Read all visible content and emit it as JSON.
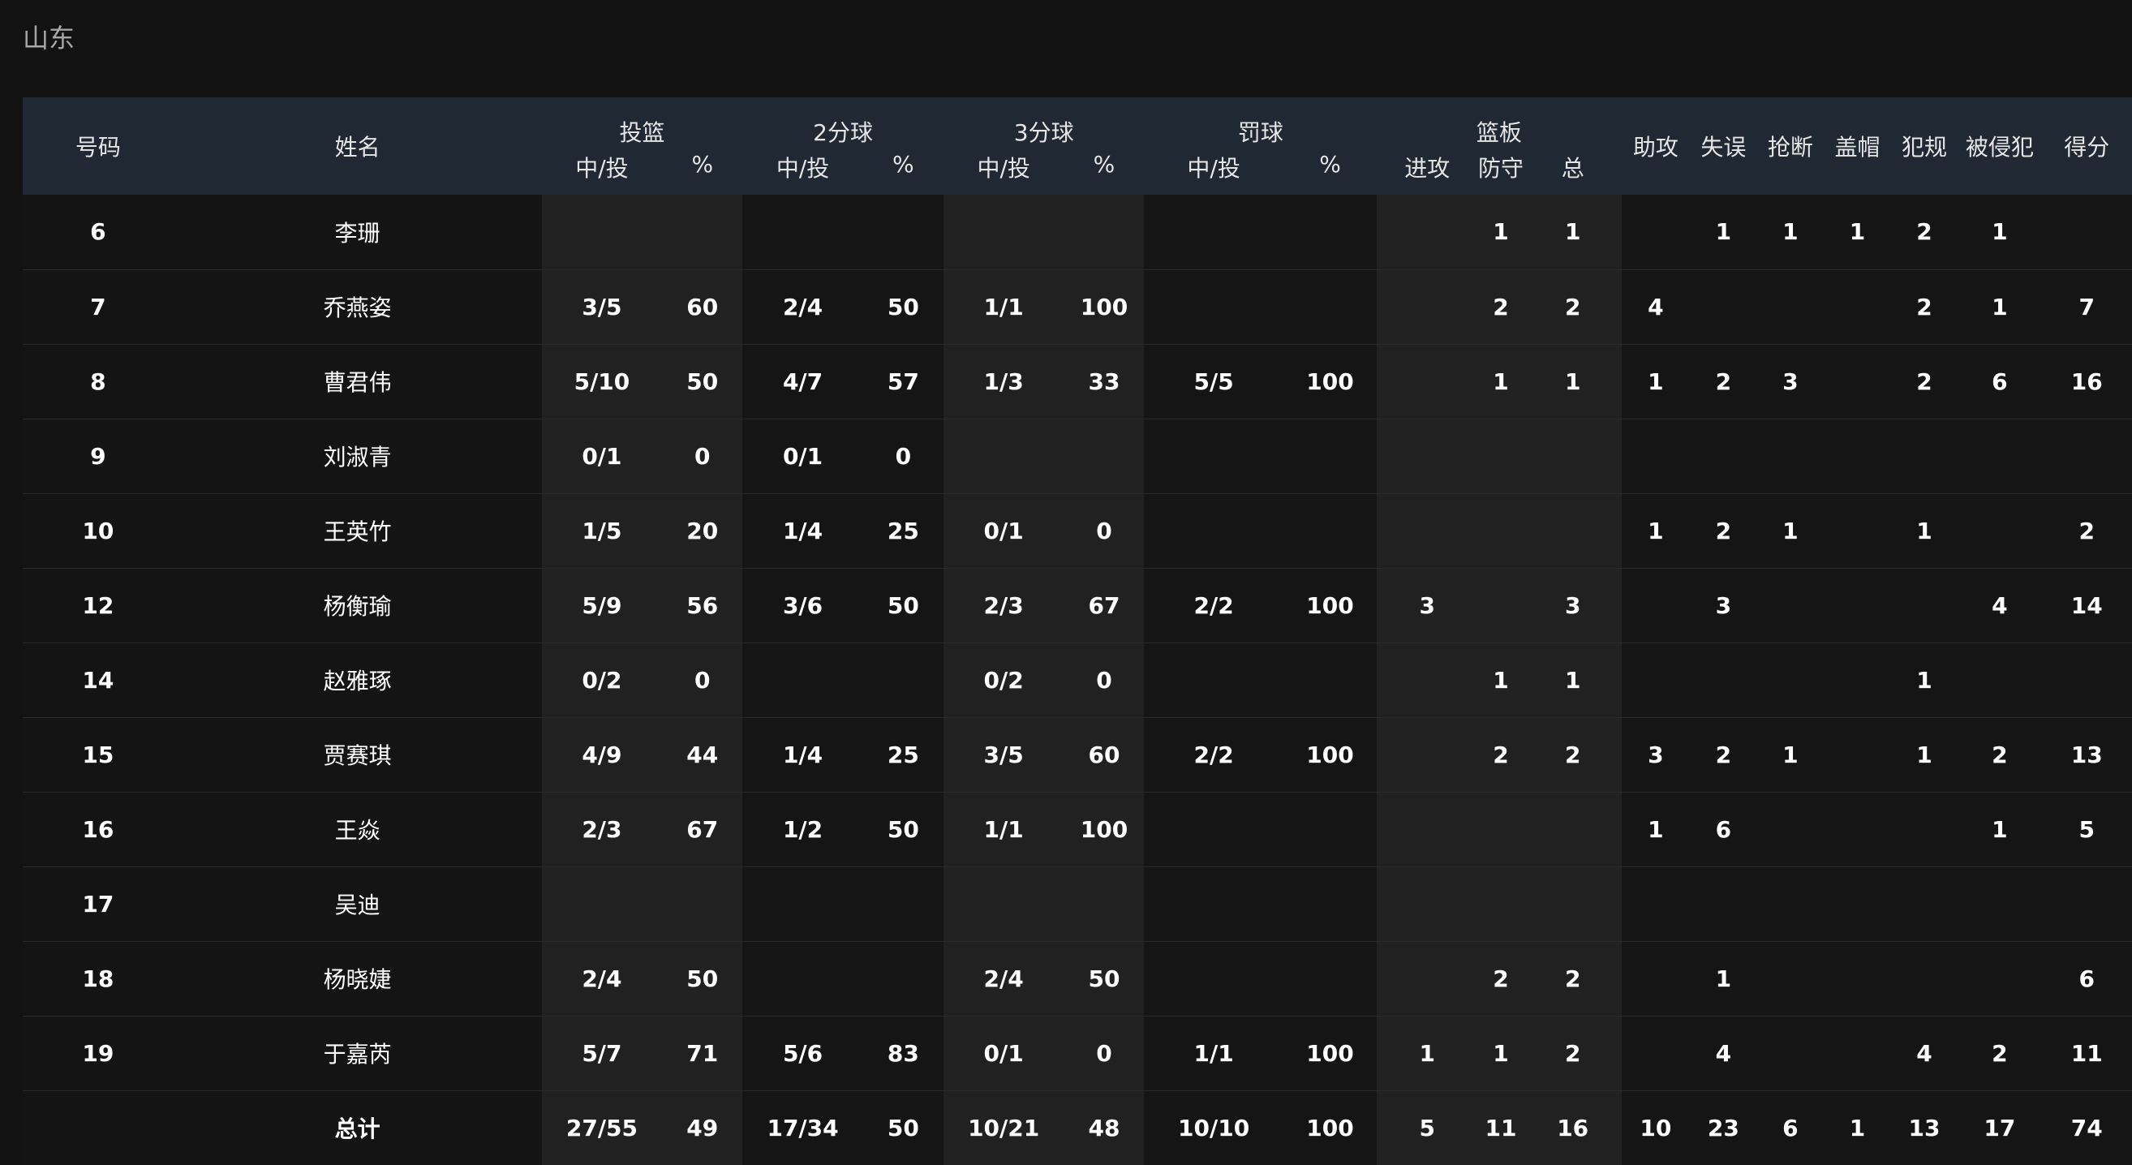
{
  "team": "山东",
  "headers": {
    "number": "号码",
    "name": "姓名",
    "groups": {
      "fg": "投篮",
      "two": "2分球",
      "three": "3分球",
      "ft": "罚球",
      "reb": "篮板"
    },
    "sub": {
      "made_att": "中/投",
      "pct": "%",
      "off": "进攻",
      "def": "防守",
      "tot": "总"
    },
    "ast": "助攻",
    "tov": "失误",
    "stl": "抢断",
    "blk": "盖帽",
    "pf": "犯规",
    "fd": "被侵犯",
    "pts": "得分"
  },
  "rows": [
    {
      "no": "6",
      "name": "李珊",
      "fg": "",
      "fg_pct": "",
      "two": "",
      "two_pct": "",
      "three": "",
      "three_pct": "",
      "ft": "",
      "ft_pct": "",
      "off": "",
      "def": "1",
      "tot": "1",
      "ast": "",
      "tov": "1",
      "stl": "1",
      "blk": "1",
      "pf": "2",
      "fd": "1",
      "pts": ""
    },
    {
      "no": "7",
      "name": "乔燕姿",
      "fg": "3/5",
      "fg_pct": "60",
      "two": "2/4",
      "two_pct": "50",
      "three": "1/1",
      "three_pct": "100",
      "ft": "",
      "ft_pct": "",
      "off": "",
      "def": "2",
      "tot": "2",
      "ast": "4",
      "tov": "",
      "stl": "",
      "blk": "",
      "pf": "2",
      "fd": "1",
      "pts": "7"
    },
    {
      "no": "8",
      "name": "曹君伟",
      "fg": "5/10",
      "fg_pct": "50",
      "two": "4/7",
      "two_pct": "57",
      "three": "1/3",
      "three_pct": "33",
      "ft": "5/5",
      "ft_pct": "100",
      "off": "",
      "def": "1",
      "tot": "1",
      "ast": "1",
      "tov": "2",
      "stl": "3",
      "blk": "",
      "pf": "2",
      "fd": "6",
      "pts": "16"
    },
    {
      "no": "9",
      "name": "刘淑青",
      "fg": "0/1",
      "fg_pct": "0",
      "two": "0/1",
      "two_pct": "0",
      "three": "",
      "three_pct": "",
      "ft": "",
      "ft_pct": "",
      "off": "",
      "def": "",
      "tot": "",
      "ast": "",
      "tov": "",
      "stl": "",
      "blk": "",
      "pf": "",
      "fd": "",
      "pts": ""
    },
    {
      "no": "10",
      "name": "王英竹",
      "fg": "1/5",
      "fg_pct": "20",
      "two": "1/4",
      "two_pct": "25",
      "three": "0/1",
      "three_pct": "0",
      "ft": "",
      "ft_pct": "",
      "off": "",
      "def": "",
      "tot": "",
      "ast": "1",
      "tov": "2",
      "stl": "1",
      "blk": "",
      "pf": "1",
      "fd": "",
      "pts": "2"
    },
    {
      "no": "12",
      "name": "杨衡瑜",
      "fg": "5/9",
      "fg_pct": "56",
      "two": "3/6",
      "two_pct": "50",
      "three": "2/3",
      "three_pct": "67",
      "ft": "2/2",
      "ft_pct": "100",
      "off": "3",
      "def": "",
      "tot": "3",
      "ast": "",
      "tov": "3",
      "stl": "",
      "blk": "",
      "pf": "",
      "fd": "4",
      "pts": "14"
    },
    {
      "no": "14",
      "name": "赵雅琢",
      "fg": "0/2",
      "fg_pct": "0",
      "two": "",
      "two_pct": "",
      "three": "0/2",
      "three_pct": "0",
      "ft": "",
      "ft_pct": "",
      "off": "",
      "def": "1",
      "tot": "1",
      "ast": "",
      "tov": "",
      "stl": "",
      "blk": "",
      "pf": "1",
      "fd": "",
      "pts": ""
    },
    {
      "no": "15",
      "name": "贾赛琪",
      "fg": "4/9",
      "fg_pct": "44",
      "two": "1/4",
      "two_pct": "25",
      "three": "3/5",
      "three_pct": "60",
      "ft": "2/2",
      "ft_pct": "100",
      "off": "",
      "def": "2",
      "tot": "2",
      "ast": "3",
      "tov": "2",
      "stl": "1",
      "blk": "",
      "pf": "1",
      "fd": "2",
      "pts": "13"
    },
    {
      "no": "16",
      "name": "王焱",
      "fg": "2/3",
      "fg_pct": "67",
      "two": "1/2",
      "two_pct": "50",
      "three": "1/1",
      "three_pct": "100",
      "ft": "",
      "ft_pct": "",
      "off": "",
      "def": "",
      "tot": "",
      "ast": "1",
      "tov": "6",
      "stl": "",
      "blk": "",
      "pf": "",
      "fd": "1",
      "pts": "5"
    },
    {
      "no": "17",
      "name": "吴迪",
      "fg": "",
      "fg_pct": "",
      "two": "",
      "two_pct": "",
      "three": "",
      "three_pct": "",
      "ft": "",
      "ft_pct": "",
      "off": "",
      "def": "",
      "tot": "",
      "ast": "",
      "tov": "",
      "stl": "",
      "blk": "",
      "pf": "",
      "fd": "",
      "pts": ""
    },
    {
      "no": "18",
      "name": "杨晓婕",
      "fg": "2/4",
      "fg_pct": "50",
      "two": "",
      "two_pct": "",
      "three": "2/4",
      "three_pct": "50",
      "ft": "",
      "ft_pct": "",
      "off": "",
      "def": "2",
      "tot": "2",
      "ast": "",
      "tov": "1",
      "stl": "",
      "blk": "",
      "pf": "",
      "fd": "",
      "pts": "6"
    },
    {
      "no": "19",
      "name": "于嘉芮",
      "fg": "5/7",
      "fg_pct": "71",
      "two": "5/6",
      "two_pct": "83",
      "three": "0/1",
      "three_pct": "0",
      "ft": "1/1",
      "ft_pct": "100",
      "off": "1",
      "def": "1",
      "tot": "2",
      "ast": "",
      "tov": "4",
      "stl": "",
      "blk": "",
      "pf": "4",
      "fd": "2",
      "pts": "11"
    },
    {
      "no": "",
      "name": "总计",
      "fg": "27/55",
      "fg_pct": "49",
      "two": "17/34",
      "two_pct": "50",
      "three": "10/21",
      "three_pct": "48",
      "ft": "10/10",
      "ft_pct": "100",
      "off": "5",
      "def": "11",
      "tot": "16",
      "ast": "10",
      "tov": "23",
      "stl": "6",
      "blk": "1",
      "pf": "13",
      "fd": "17",
      "pts": "74"
    }
  ]
}
